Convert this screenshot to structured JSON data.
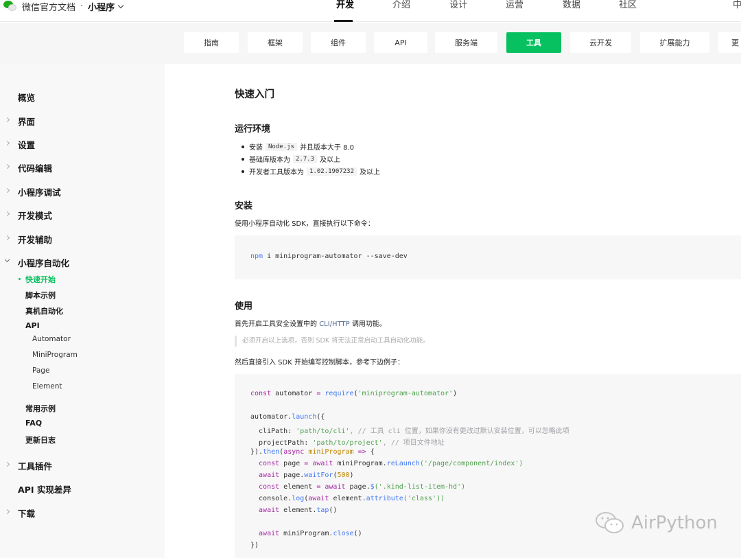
{
  "brand": {
    "name": "微信官方文档",
    "separator": "·",
    "product": "小程序"
  },
  "nav": [
    {
      "label": "开发",
      "active": true
    },
    {
      "label": "介绍"
    },
    {
      "label": "设计"
    },
    {
      "label": "运营"
    },
    {
      "label": "数据"
    },
    {
      "label": "社区"
    }
  ],
  "nav_right": "中",
  "tabs": [
    {
      "label": "指南"
    },
    {
      "label": "框架"
    },
    {
      "label": "组件"
    },
    {
      "label": "API"
    },
    {
      "label": "服务端"
    },
    {
      "label": "工具",
      "active": true
    },
    {
      "label": "云开发"
    },
    {
      "label": "扩展能力"
    },
    {
      "label": "更"
    }
  ],
  "sidebar": {
    "overview": "概览",
    "interface": "界面",
    "settings": "设置",
    "code_edit": "代码编辑",
    "debug": "小程序调试",
    "dev_mode": "开发模式",
    "dev_assist": "开发辅助",
    "automation": "小程序自动化",
    "quick_start": "快速开始",
    "script_examples": "脚本示例",
    "real_device": "真机自动化",
    "api": "API",
    "api_automator": "Automator",
    "api_miniprogram": "MiniProgram",
    "api_page": "Page",
    "api_element": "Element",
    "common_examples": "常用示例",
    "faq": "FAQ",
    "changelog": "更新日志",
    "plugins": "工具插件",
    "api_diff": "API 实现差异",
    "download": "下载"
  },
  "content": {
    "title": "快速入门",
    "env": {
      "heading": "运行环境",
      "items": [
        {
          "pre": "安装",
          "code": "Node.js",
          "post": "并且版本大于 8.0"
        },
        {
          "pre": "基础库版本为",
          "code": "2.7.3",
          "post": "及以上"
        },
        {
          "pre": "开发者工具版本为",
          "code": "1.02.1907232",
          "post": "及以上"
        }
      ]
    },
    "install": {
      "heading": "安装",
      "desc": "使用小程序自动化 SDK，直接执行以下命令：",
      "cmd_npm": "npm",
      "cmd_rest": " i miniprogram-automator --save-dev"
    },
    "usage": {
      "heading": "使用",
      "desc_pre": "首先开启工具安全设置中的 ",
      "desc_link": "CLI/HTTP",
      "desc_post": " 调用功能。",
      "note": "必须开启以上选项，否则 SDK 将无法正常启动工具自动化功能。",
      "desc2": "然后直接引入 SDK 开始编写控制脚本，参考下边例子："
    },
    "code": {
      "l1_k": "const",
      "l1_a": " automator ",
      "l1_eq": "=",
      "l1_f": " require",
      "l1_b": "(",
      "l1_s": "'miniprogram-automator'",
      "l1_e": ")",
      "l2_a": "automator.",
      "l2_f": "launch",
      "l2_b": "({",
      "l3_a": "  cliPath: ",
      "l3_s": "'path/to/cli'",
      "l3_c": ", // 工具 cli 位置，如果你没有更改过默认安装位置，可以忽略此项",
      "l4_a": "  projectPath: ",
      "l4_s": "'path/to/project'",
      "l4_c": ", // 项目文件地址",
      "l5_a": "}).",
      "l5_f": "then",
      "l5_b": "(",
      "l5_k": "async",
      "l5_p": " miniProgram",
      "l5_ar": " =>",
      "l5_e": " {",
      "l6_k": "  const",
      "l6_a": " page ",
      "l6_eq": "=",
      "l6_k2": " await",
      "l6_b": " miniProgram.",
      "l6_f": "reLaunch",
      "l6_s": "('/page/component/index')",
      "l7_k": "  await",
      "l7_a": " page.",
      "l7_f": "waitFor",
      "l7_b": "(",
      "l7_n": "500",
      "l7_e": ")",
      "l8_k": "  const",
      "l8_a": " element ",
      "l8_eq": "=",
      "l8_k2": " await",
      "l8_b": " page.",
      "l8_f": "$",
      "l8_s": "('.kind-list-item-hd')",
      "l9_a": "  console.",
      "l9_f": "log",
      "l9_b": "(",
      "l9_k": "await",
      "l9_c": " element.",
      "l9_f2": "attribute",
      "l9_s": "('class'))",
      "l10_k": "  await",
      "l10_a": " element.",
      "l10_f": "tap",
      "l10_b": "()",
      "l11_k": "  await",
      "l11_a": " miniProgram.",
      "l11_f": "close",
      "l11_b": "()",
      "l12": "})"
    }
  },
  "watermark": "AirPython",
  "colors": {
    "accent": "#07c160",
    "link": "#576b95"
  }
}
